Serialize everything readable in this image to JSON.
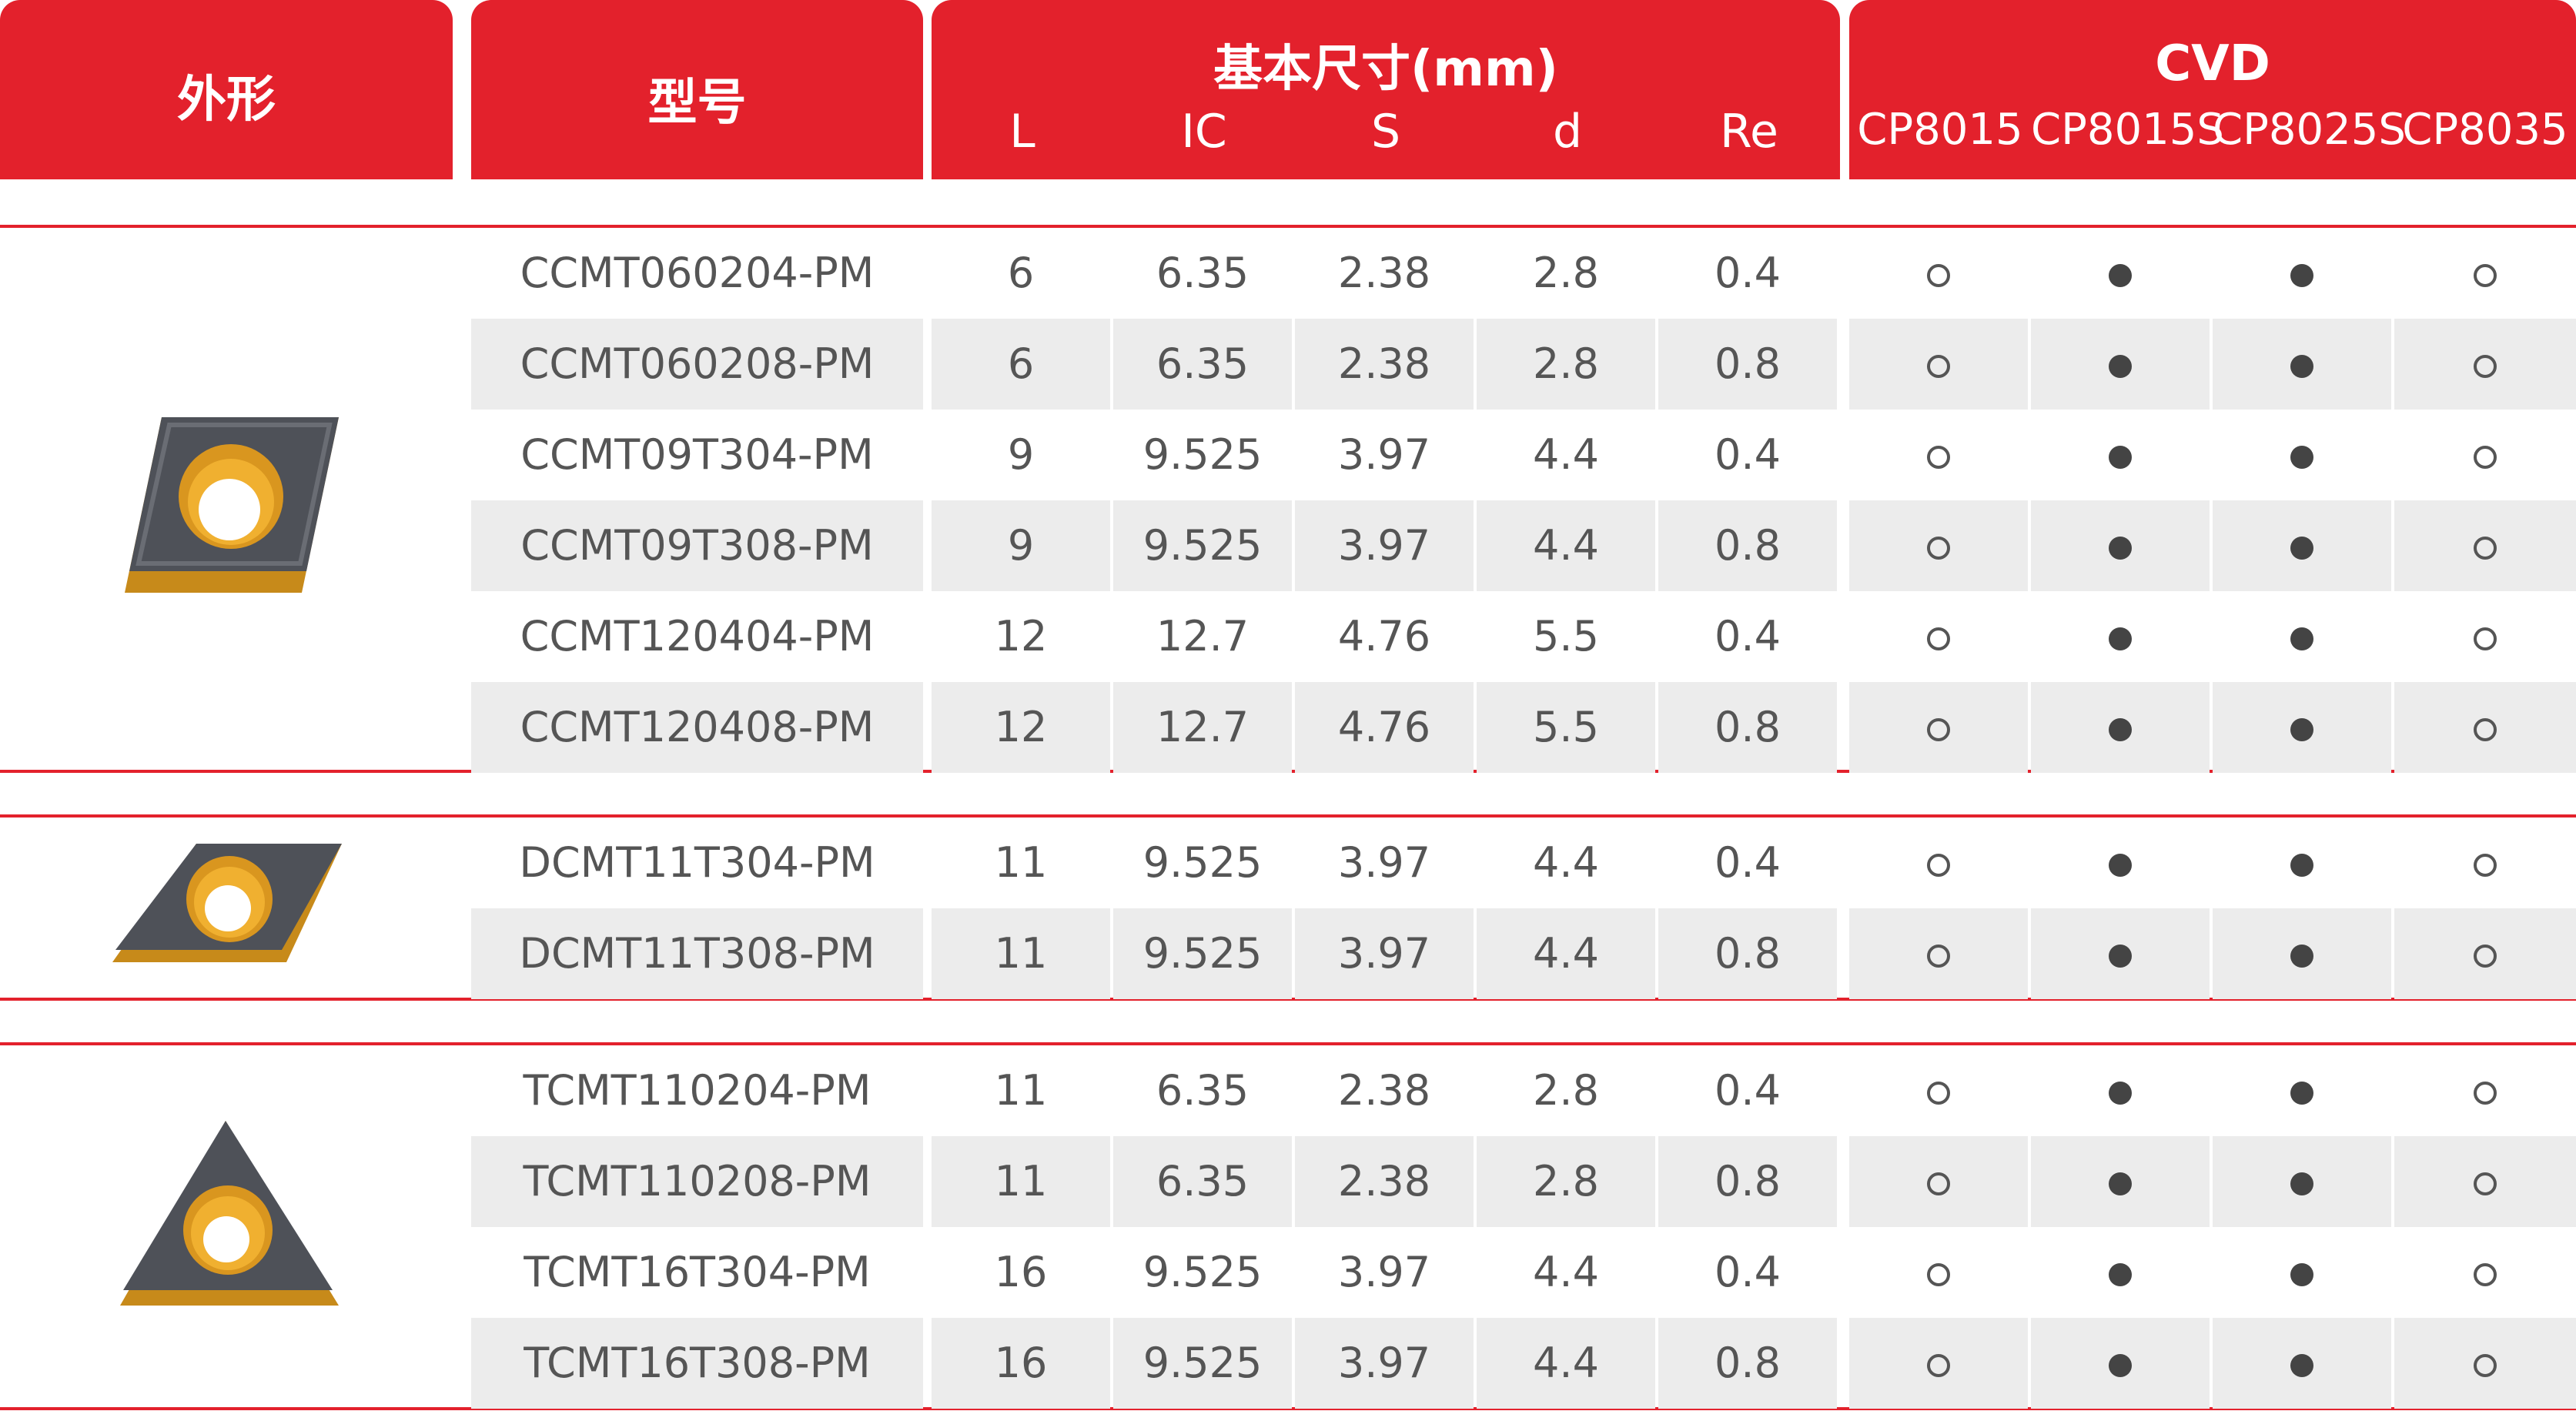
{
  "header": {
    "shape_label": "外形",
    "model_label": "型号",
    "dims_label": "基本尺寸(mm)",
    "dims_cols": [
      "L",
      "IC",
      "S",
      "d",
      "Re"
    ],
    "cvd_label": "CVD",
    "grades": [
      "CP8015",
      "CP8015S",
      "CP8025S",
      "CP8035"
    ]
  },
  "groups": [
    {
      "shape_icon": "ccmt-rhombic-80-insert-icon",
      "rows": [
        {
          "model": "CCMT060204-PM",
          "L": "6",
          "IC": "6.35",
          "S": "2.38",
          "d": "2.8",
          "Re": "0.4",
          "marks": [
            "open",
            "filled",
            "filled",
            "open"
          ]
        },
        {
          "model": "CCMT060208-PM",
          "L": "6",
          "IC": "6.35",
          "S": "2.38",
          "d": "2.8",
          "Re": "0.8",
          "marks": [
            "open",
            "filled",
            "filled",
            "open"
          ]
        },
        {
          "model": "CCMT09T304-PM",
          "L": "9",
          "IC": "9.525",
          "S": "3.97",
          "d": "4.4",
          "Re": "0.4",
          "marks": [
            "open",
            "filled",
            "filled",
            "open"
          ]
        },
        {
          "model": "CCMT09T308-PM",
          "L": "9",
          "IC": "9.525",
          "S": "3.97",
          "d": "4.4",
          "Re": "0.8",
          "marks": [
            "open",
            "filled",
            "filled",
            "open"
          ]
        },
        {
          "model": "CCMT120404-PM",
          "L": "12",
          "IC": "12.7",
          "S": "4.76",
          "d": "5.5",
          "Re": "0.4",
          "marks": [
            "open",
            "filled",
            "filled",
            "open"
          ]
        },
        {
          "model": "CCMT120408-PM",
          "L": "12",
          "IC": "12.7",
          "S": "4.76",
          "d": "5.5",
          "Re": "0.8",
          "marks": [
            "open",
            "filled",
            "filled",
            "open"
          ]
        }
      ]
    },
    {
      "shape_icon": "dcmt-rhombic-55-insert-icon",
      "rows": [
        {
          "model": "DCMT11T304-PM",
          "L": "11",
          "IC": "9.525",
          "S": "3.97",
          "d": "4.4",
          "Re": "0.4",
          "marks": [
            "open",
            "filled",
            "filled",
            "open"
          ]
        },
        {
          "model": "DCMT11T308-PM",
          "L": "11",
          "IC": "9.525",
          "S": "3.97",
          "d": "4.4",
          "Re": "0.8",
          "marks": [
            "open",
            "filled",
            "filled",
            "open"
          ]
        }
      ]
    },
    {
      "shape_icon": "tcmt-triangular-insert-icon",
      "rows": [
        {
          "model": "TCMT110204-PM",
          "L": "11",
          "IC": "6.35",
          "S": "2.38",
          "d": "2.8",
          "Re": "0.4",
          "marks": [
            "open",
            "filled",
            "filled",
            "open"
          ]
        },
        {
          "model": "TCMT110208-PM",
          "L": "11",
          "IC": "6.35",
          "S": "2.38",
          "d": "2.8",
          "Re": "0.8",
          "marks": [
            "open",
            "filled",
            "filled",
            "open"
          ]
        },
        {
          "model": "TCMT16T304-PM",
          "L": "16",
          "IC": "9.525",
          "S": "3.97",
          "d": "4.4",
          "Re": "0.4",
          "marks": [
            "open",
            "filled",
            "filled",
            "open"
          ]
        },
        {
          "model": "TCMT16T308-PM",
          "L": "16",
          "IC": "9.525",
          "S": "3.97",
          "d": "4.4",
          "Re": "0.8",
          "marks": [
            "open",
            "filled",
            "filled",
            "open"
          ]
        }
      ]
    }
  ],
  "colors": {
    "accent": "#e3212c",
    "row_shade": "#ececec",
    "text": "#555555"
  }
}
